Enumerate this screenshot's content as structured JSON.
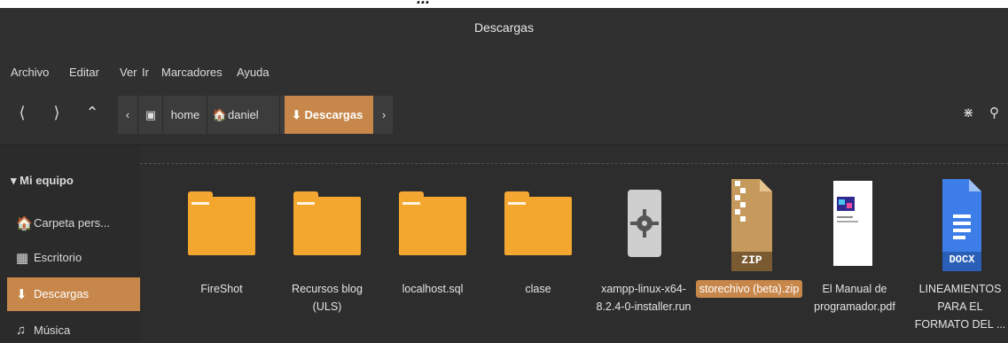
{
  "strip_text": "... ~ ~ ~",
  "window": {
    "title": "Descargas"
  },
  "menubar": {
    "items": [
      "Archivo",
      "Editar",
      "Ver",
      "Ir",
      "Marcadores",
      "Ayuda"
    ]
  },
  "pathbar": {
    "crumbs": [
      "home",
      "daniel",
      "Descargas"
    ]
  },
  "sidebar": {
    "section_label": "Mi equipo",
    "items": [
      {
        "label": "Carpeta pers...",
        "icon": "home-icon"
      },
      {
        "label": "Escritorio",
        "icon": "desktop-icon"
      },
      {
        "label": "Descargas",
        "icon": "downloads-icon",
        "active": true
      },
      {
        "label": "Música",
        "icon": "music-icon"
      }
    ]
  },
  "files": [
    {
      "name": "FireShot",
      "type": "folder"
    },
    {
      "name": "Recursos blog (ULS)",
      "type": "folder"
    },
    {
      "name": "localhost.sql",
      "type": "folder"
    },
    {
      "name": "clase",
      "type": "folder"
    },
    {
      "name": "xampp-linux-x64-8.2.4-0-installer.run",
      "type": "installer"
    },
    {
      "name": "storechivo (beta).zip",
      "type": "zip",
      "badge": "ZIP",
      "selected": true
    },
    {
      "name": "El Manual de programador.pdf",
      "type": "pdf"
    },
    {
      "name": "LINEAMIENTOS PARA EL FORMATO DEL ...",
      "type": "docx",
      "badge": "DOCX"
    }
  ],
  "colors": {
    "accent": "#c7874b",
    "folder": "#f4a72f",
    "window_bg": "#2b2b2b"
  }
}
